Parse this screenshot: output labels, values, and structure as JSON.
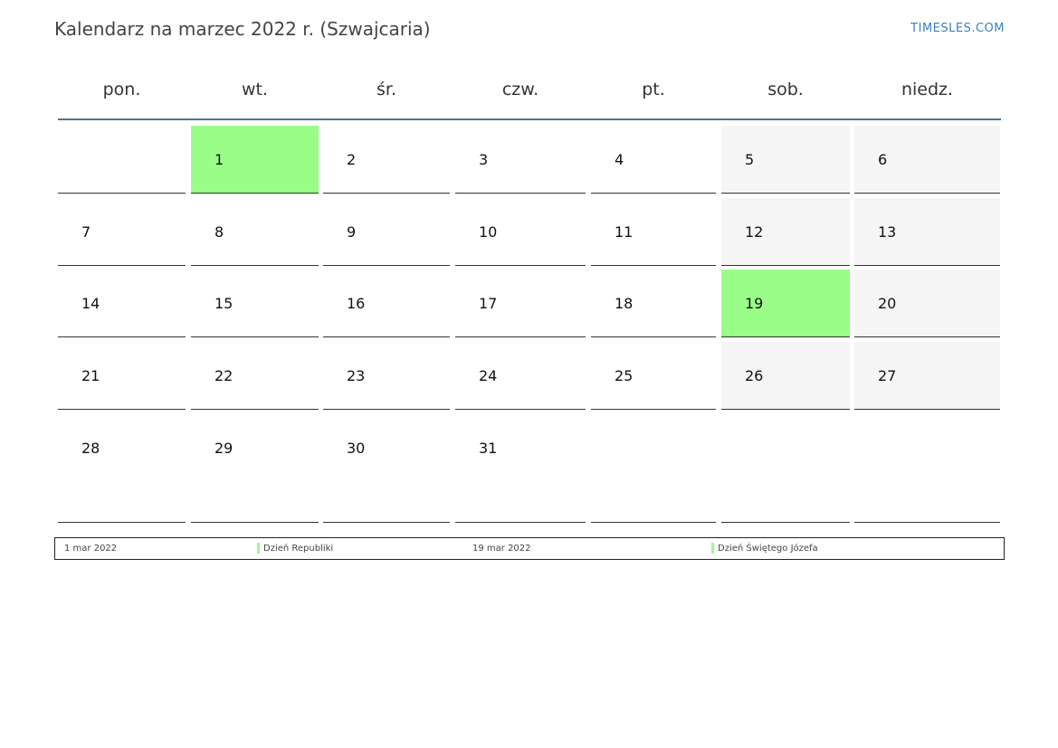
{
  "title": "Kalendarz na marzec 2022 r. (Szwajcaria)",
  "brand": "TIMESLES.COM",
  "weekdays": [
    "pon.",
    "wt.",
    "śr.",
    "czw.",
    "pt.",
    "sob.",
    "niedz."
  ],
  "weeks": [
    [
      "",
      "1",
      "2",
      "3",
      "4",
      "5",
      "6"
    ],
    [
      "7",
      "8",
      "9",
      "10",
      "11",
      "12",
      "13"
    ],
    [
      "14",
      "15",
      "16",
      "17",
      "18",
      "19",
      "20"
    ],
    [
      "21",
      "22",
      "23",
      "24",
      "25",
      "26",
      "27"
    ],
    [
      "28",
      "29",
      "30",
      "31",
      "",
      "",
      ""
    ]
  ],
  "holiday_days": [
    "1",
    "19"
  ],
  "colors": {
    "holiday": "#9afd88",
    "weekend": "#f5f5f5",
    "accent_rule": "#56708a",
    "brand": "#3a7fc1"
  },
  "legend": [
    {
      "date": "1 mar 2022",
      "name": "Dzień Republiki"
    },
    {
      "date": "19 mar 2022",
      "name": "Dzień Świętego Józefa"
    }
  ]
}
